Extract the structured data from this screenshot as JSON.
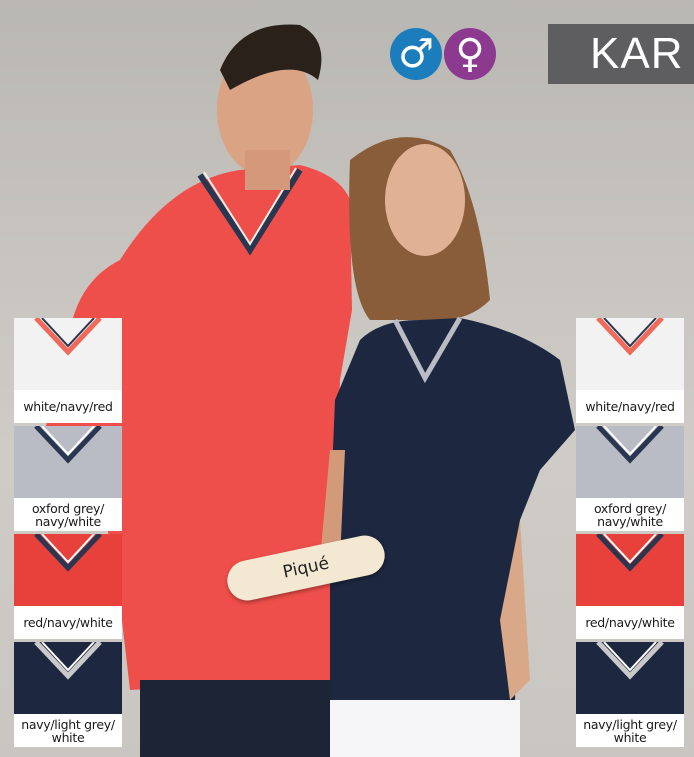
{
  "brand": {
    "text": "KAR"
  },
  "gender_icons": [
    {
      "name": "male-symbol-icon",
      "glyph": "♂",
      "color": "#1c7dbd"
    },
    {
      "name": "female-symbol-icon",
      "glyph": "♀",
      "color": "#8b3a8f"
    }
  ],
  "fabric_badge": {
    "text": "Piqué"
  },
  "swatches_left": [
    {
      "label": "white/navy/red",
      "body": "#f2f2f2",
      "trim": "#ef6a5a",
      "trim2": "#2a3550"
    },
    {
      "label": "oxford grey/ navy/white",
      "body": "#b9bcc4",
      "trim": "#2a3550",
      "trim2": "#ffffff"
    },
    {
      "label": "red/navy/white",
      "body": "#e8403a",
      "trim": "#2a3550",
      "trim2": "#ffffff"
    },
    {
      "label": "navy/light grey/ white",
      "body": "#1e2740",
      "trim": "#c9c9c9",
      "trim2": "#ffffff"
    }
  ],
  "swatches_right": [
    {
      "label": "white/navy/red",
      "body": "#f2f2f2",
      "trim": "#ef6a5a",
      "trim2": "#2a3550"
    },
    {
      "label": "oxford grey/ navy/white",
      "body": "#b9bcc4",
      "trim": "#2a3550",
      "trim2": "#ffffff"
    },
    {
      "label": "red/navy/white",
      "body": "#e8403a",
      "trim": "#2a3550",
      "trim2": "#ffffff"
    },
    {
      "label": "navy/light grey/ white",
      "body": "#1e2740",
      "trim": "#c9c9c9",
      "trim2": "#ffffff"
    }
  ]
}
